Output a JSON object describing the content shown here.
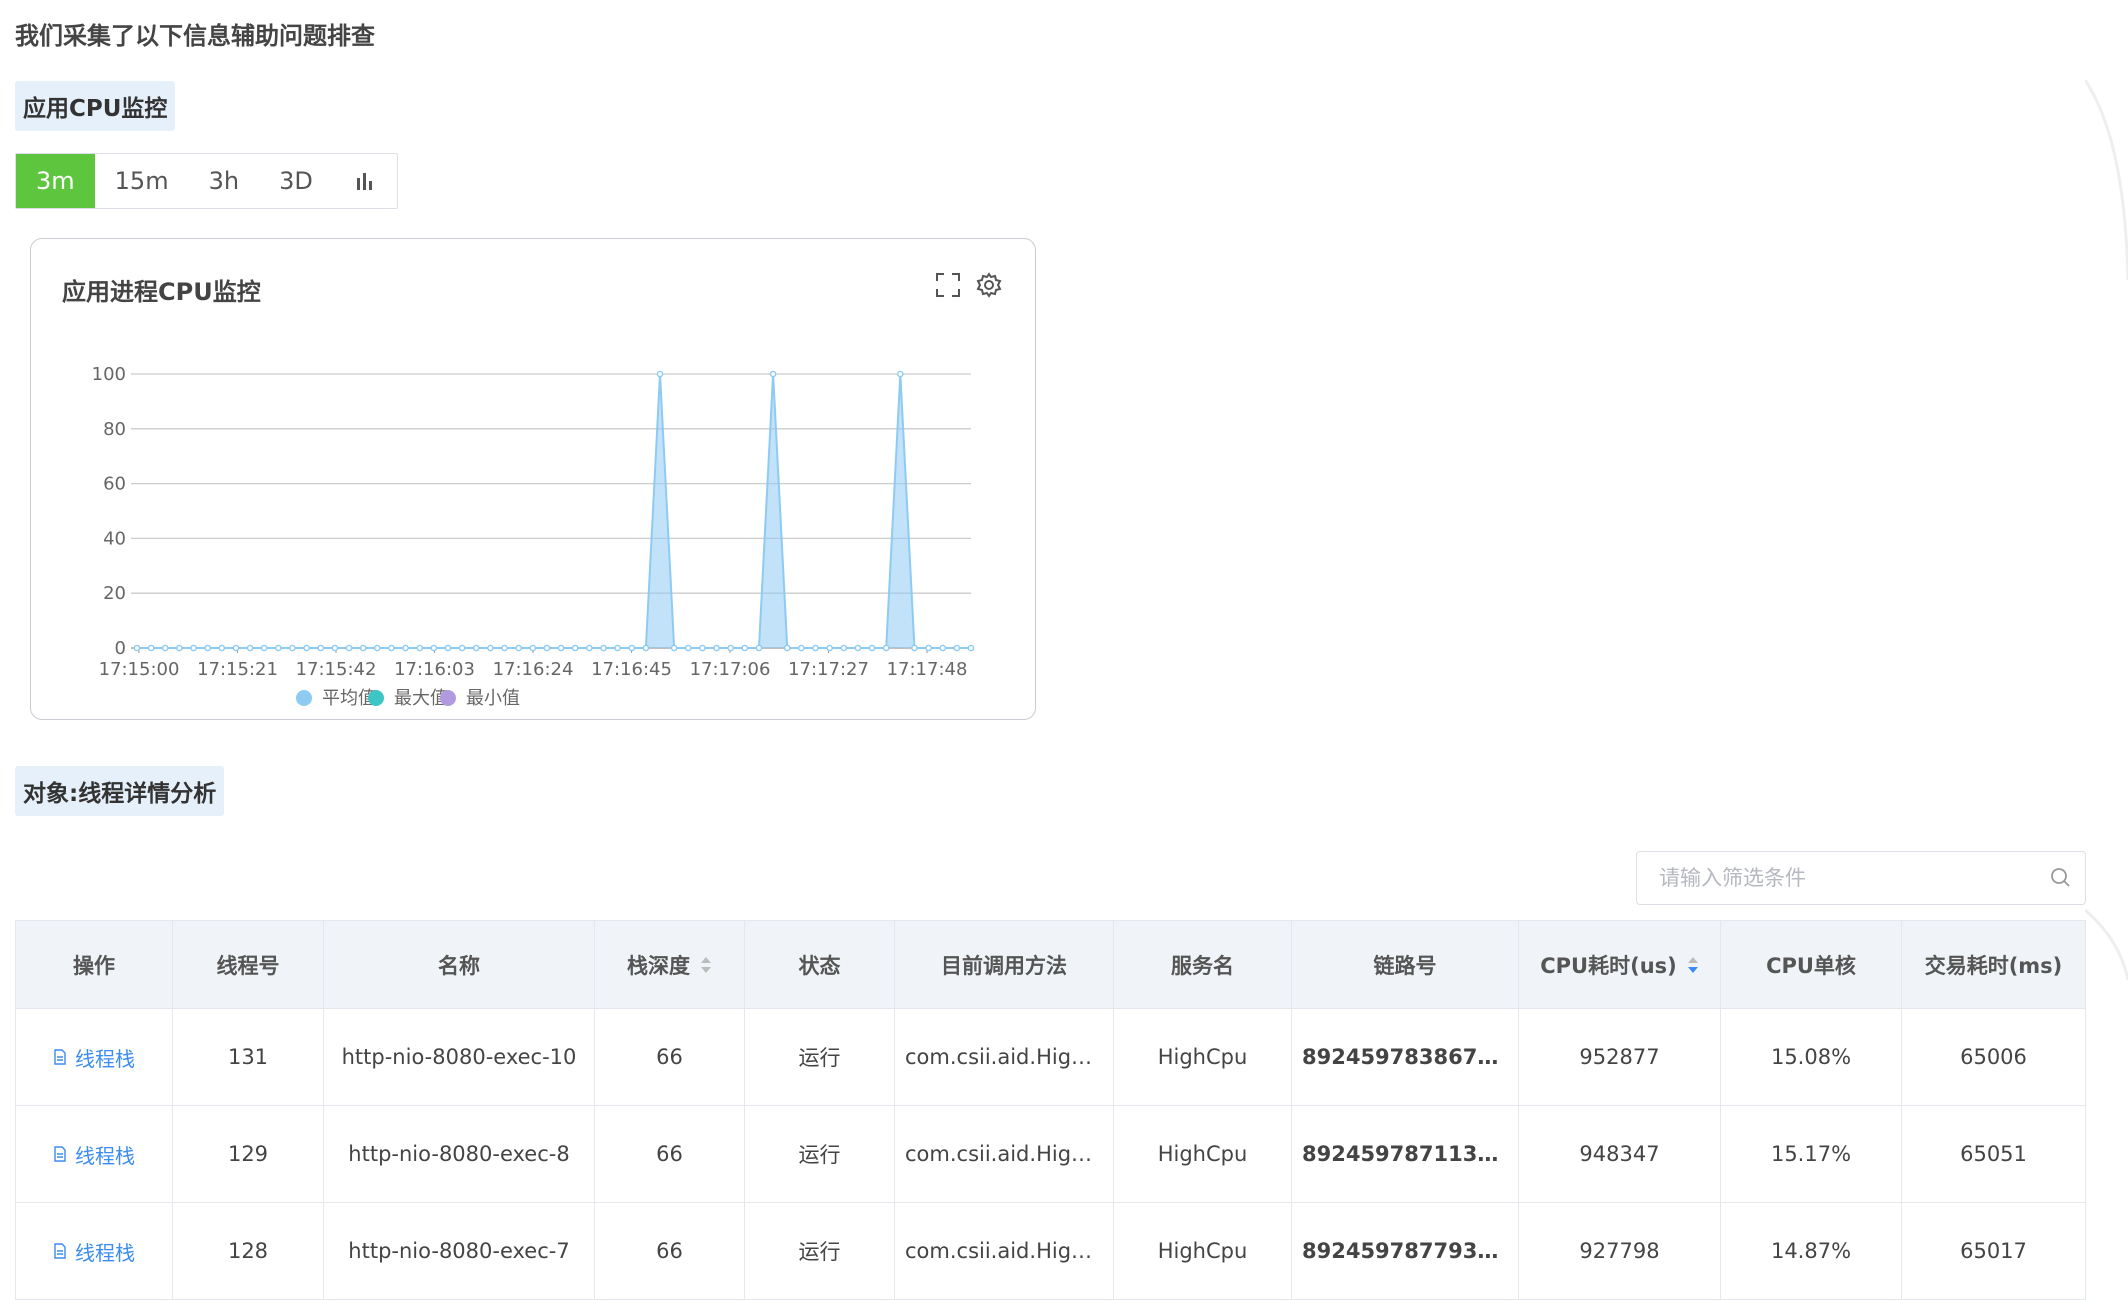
{
  "intro": "我们采集了以下信息辅助问题排查",
  "section1_title": "应用CPU监控",
  "range_tabs": [
    {
      "label": "3m",
      "active": true
    },
    {
      "label": "15m",
      "active": false
    },
    {
      "label": "3h",
      "active": false
    },
    {
      "label": "3D",
      "active": false
    }
  ],
  "bar_chart_icon": "bar-chart-icon",
  "card": {
    "title": "应用进程CPU监控",
    "tools": [
      "fullscreen-icon",
      "gear-icon"
    ]
  },
  "chart_data": {
    "type": "area",
    "title": "",
    "xlabel": "",
    "ylabel": "",
    "ylim": [
      0,
      100
    ],
    "yticks": [
      "100",
      "80",
      "60",
      "40",
      "20",
      "0"
    ],
    "xticks": [
      "17:15:00",
      "17:15:21",
      "17:15:42",
      "17:16:03",
      "17:16:24",
      "17:16:45",
      "17:17:06",
      "17:17:27",
      "17:17:48"
    ],
    "grid": true,
    "legend_position": "bottom",
    "series": [
      {
        "name": "平均值",
        "color": "#8ecbf3",
        "spikes_at_point_index": [
          37,
          45,
          54
        ],
        "spike_value": 100,
        "base_value": 0,
        "point_count": 60
      },
      {
        "name": "最大值",
        "color": "#3ec5c5"
      },
      {
        "name": "最小值",
        "color": "#b29ae0"
      }
    ]
  },
  "section2_title": "对象:线程详情分析",
  "search": {
    "placeholder": "请输入筛选条件"
  },
  "table": {
    "headers": [
      "操作",
      "线程号",
      "名称",
      "栈深度",
      "状态",
      "目前调用方法",
      "服务名",
      "链路号",
      "CPU耗时(us)",
      "CPU单核",
      "交易耗时(ms)"
    ],
    "rows": [
      {
        "op": "线程栈",
        "tid": "131",
        "name": "http-nio-8080-exec-10",
        "depth": "66",
        "state": "运行",
        "method": "com.csii.aid.High…",
        "service": "HighCpu",
        "trace": "89245978386750…",
        "cpu": "952877",
        "core": "15.08%",
        "tx": "65006"
      },
      {
        "op": "线程栈",
        "tid": "129",
        "name": "http-nio-8080-exec-8",
        "depth": "66",
        "state": "运行",
        "method": "com.csii.aid.High…",
        "service": "HighCpu",
        "trace": "89245978711389…",
        "cpu": "948347",
        "core": "15.17%",
        "tx": "65051"
      },
      {
        "op": "线程栈",
        "tid": "128",
        "name": "http-nio-8080-exec-7",
        "depth": "66",
        "state": "运行",
        "method": "com.csii.aid.High…",
        "service": "HighCpu",
        "trace": "89245978779337…",
        "cpu": "927798",
        "core": "14.87%",
        "tx": "65017"
      }
    ]
  },
  "colors": {
    "accent_green": "#5ec63e",
    "link_blue": "#3b8cf0",
    "tag_bg": "#e6f0fa"
  }
}
